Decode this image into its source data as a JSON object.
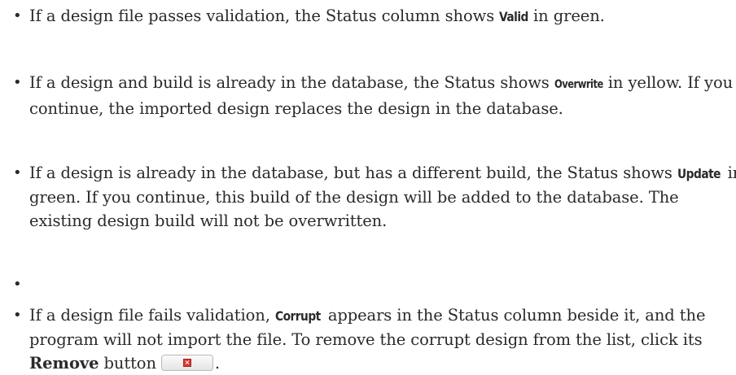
{
  "bullet_char": "•",
  "items": [
    {
      "pre": "If a design file passes validation, the Status column shows ",
      "kw": "Valid",
      "post": " in green."
    },
    {
      "pre": "If a design and build is already in the database, the Status shows ",
      "kw": "Overwrite",
      "post": " in yellow. If you continue, the imported design replaces the design in the database."
    },
    {
      "pre": "If a design is already in the database, but has a different build, the Status shows ",
      "kw": "Update",
      "post": " in green. If you continue, this build of the design will be added to the database. The existing design build will not be overwritten."
    },
    {
      "pre": ""
    },
    {
      "pre": "If a design file fails validation, ",
      "kw": "Corrupt",
      "mid": " appears in the Status column beside it, and the program will not import the file. To remove the corrupt design from the list, click its ",
      "kw2": "Remove",
      "mid2": " button",
      "post": "."
    }
  ],
  "remove_button": {
    "icon": "remove-x-icon",
    "glyph": "×",
    "icon_color": "#d9362f"
  }
}
